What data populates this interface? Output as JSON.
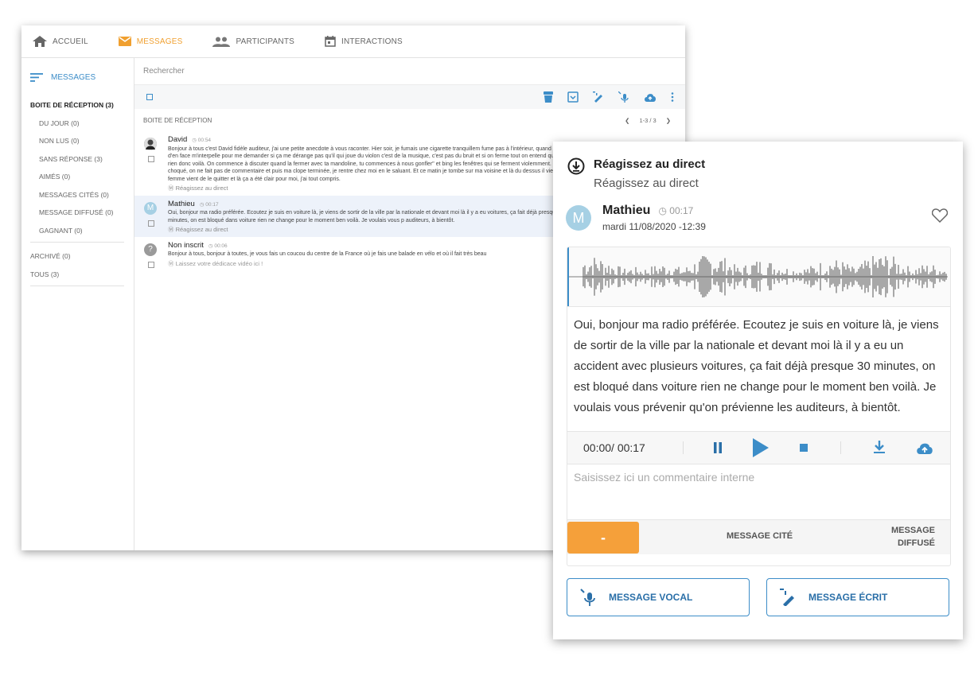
{
  "nav": {
    "tabs": [
      {
        "label": "ACCUEIL",
        "icon": "home-icon"
      },
      {
        "label": "MESSAGES",
        "icon": "mail-icon"
      },
      {
        "label": "PARTICIPANTS",
        "icon": "people-icon"
      },
      {
        "label": "INTERACTIONS",
        "icon": "calendar-icon"
      }
    ],
    "active": "MESSAGES"
  },
  "sidebar": {
    "title": "MESSAGES",
    "items": [
      {
        "label": "BOITE DE RÉCEPTION (3)"
      },
      {
        "label": "DU JOUR (0)"
      },
      {
        "label": "NON LUS (0)"
      },
      {
        "label": "SANS RÉPONSE (3)"
      },
      {
        "label": "AIMÉS (0)"
      },
      {
        "label": "MESSAGES CITÉS (0)"
      },
      {
        "label": "MESSAGE DIFFUSÉ (0)"
      },
      {
        "label": "GAGNANT (0)"
      },
      {
        "label": "ARCHIVÉ (0)"
      },
      {
        "label": "TOUS (3)"
      }
    ]
  },
  "search": {
    "placeholder": "Rechercher"
  },
  "inbox": {
    "title": "BOITE DE RÉCEPTION",
    "pager": "1-3 / 3"
  },
  "messages": [
    {
      "name": "David",
      "time": "00:54",
      "text": "Bonjour à tous c'est David fidèle auditeur, j'ai une petite anecdote à vous raconter. Hier soir, je fumais une cigarette tranquillem fume pas à l'intérieur, quand mon voisin d'en face m'interpelle pour me demander si ça me dérange pas qu'il qui joue du violon c'est de la musique, c'est pas du bruit et si on ferme tout on entend quasiment rien donc voilà. On commence à discuter quand la fermer avec ta mandoline, tu commences à nous gonfler\" et bing les fenêtres qui se ferment violemment. On est choqué, on ne fait pas de commentaire et puis ma clope terminée, je rentre chez moi en le saluant. Et ce matin je tombe sur ma voisine et là du dessus il vient de... sa femme vient de le quitter et là ça a été clair pour moi, j'ai tout compris.",
      "tag": "Réagissez au direct"
    },
    {
      "name": "Mathieu",
      "initial": "M",
      "time": "00:17",
      "text": "Oui, bonjour ma radio préférée. Ecoutez je suis en voiture là, je viens de sortir de la ville par la nationale et devant moi là il y a eu voitures, ça fait déjà presque 30 minutes, on est bloqué dans voiture rien ne change pour le moment ben voilà. Je voulais vous p auditeurs, à bientôt.",
      "tag": "Réagissez au direct"
    },
    {
      "name": "Non inscrit",
      "initial": "?",
      "time": "00:06",
      "text": "Bonjour à tous, bonjour à toutes, je vous fais un coucou du centre de la France où je fais une balade en vélo et où il fait très beau",
      "tag": "Laissez votre dédicace vidéo ici !"
    }
  ],
  "detail": {
    "title": "Réagissez au direct",
    "subtitle": "Réagissez au direct",
    "name": "Mathieu",
    "initial": "M",
    "time": "00:17",
    "date": "mardi 11/08/2020 -12:39",
    "text": "Oui, bonjour ma radio préférée. Ecoutez je suis en voiture là, je viens de sortir de la ville par la nationale et devant moi là il y a eu un accident avec plusieurs voitures, ça fait déjà presque 30 minutes, on est bloqué dans voiture rien ne change pour le moment ben voilà. Je voulais vous prévenir qu'on prévienne les auditeurs, à bientôt.",
    "player_time": "00:00/ 00:17",
    "comment_placeholder": "Saisissez ici un commentaire interne",
    "status_left": "-",
    "status_cite": "MESSAGE CITÉ",
    "status_diff": "MESSAGE DIFFUSÉ",
    "btn_vocal": "MESSAGE VOCAL",
    "btn_ecrit": "MESSAGE ÉCRIT"
  },
  "colors": {
    "accent": "#3c8dc8",
    "orange": "#f5a03a"
  }
}
